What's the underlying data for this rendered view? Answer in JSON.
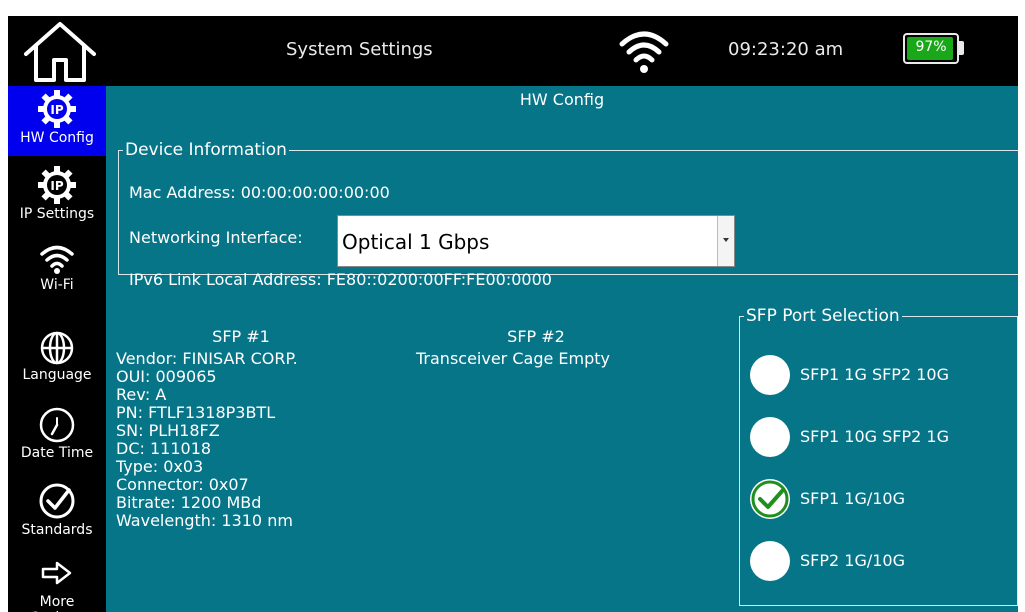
{
  "header": {
    "title": "System Settings",
    "time": "09:23:20 am",
    "battery": "97%",
    "battery_level": 0.97
  },
  "sidebar": {
    "items": [
      {
        "label": "HW Config",
        "icon": "ip-gear-icon",
        "active": true
      },
      {
        "label": "IP Settings",
        "icon": "ip-gear-icon",
        "active": false
      },
      {
        "label": "Wi-Fi",
        "icon": "wifi-icon",
        "active": false
      },
      {
        "label": "Language",
        "icon": "globe-icon",
        "active": false
      },
      {
        "label": "Date Time",
        "icon": "clock-icon",
        "active": false
      },
      {
        "label": "Standards",
        "icon": "check-circle-icon",
        "active": false
      },
      {
        "label": "More Options",
        "icon": "arrow-right-icon",
        "active": false
      }
    ]
  },
  "main": {
    "section_title": "HW Config",
    "device_info": {
      "legend": "Device Information",
      "mac": "Mac Address: 00:00:00:00:00:00",
      "net_label": "Networking Interface:",
      "net_value": "Optical 1 Gbps",
      "ipv6": "IPv6 Link Local Address: FE80::0200:00FF:FE00:0000"
    },
    "sfp1": {
      "title": "SFP #1",
      "lines": [
        "Vendor: FINISAR CORP.",
        "OUI: 009065",
        "Rev: A",
        "PN: FTLF1318P3BTL",
        "SN: PLH18FZ",
        "DC: 111018",
        "Type: 0x03",
        "Connector: 0x07",
        "Bitrate: 1200 MBd",
        "Wavelength: 1310 nm"
      ]
    },
    "sfp2": {
      "title": "SFP #2",
      "status": "Transceiver Cage Empty"
    },
    "port_selection": {
      "legend": "SFP Port Selection",
      "options": [
        {
          "label": "SFP1 1G SFP2 10G",
          "selected": false
        },
        {
          "label": "SFP1 10G SFP2 1G",
          "selected": false
        },
        {
          "label": "SFP1 1G/10G",
          "selected": true
        },
        {
          "label": "SFP2 1G/10G",
          "selected": false
        }
      ]
    }
  },
  "colors": {
    "panel": "#077588",
    "active_nav": "#0000ee",
    "battery_green": "#1aa81a",
    "check_green": "#1f8f1f"
  }
}
